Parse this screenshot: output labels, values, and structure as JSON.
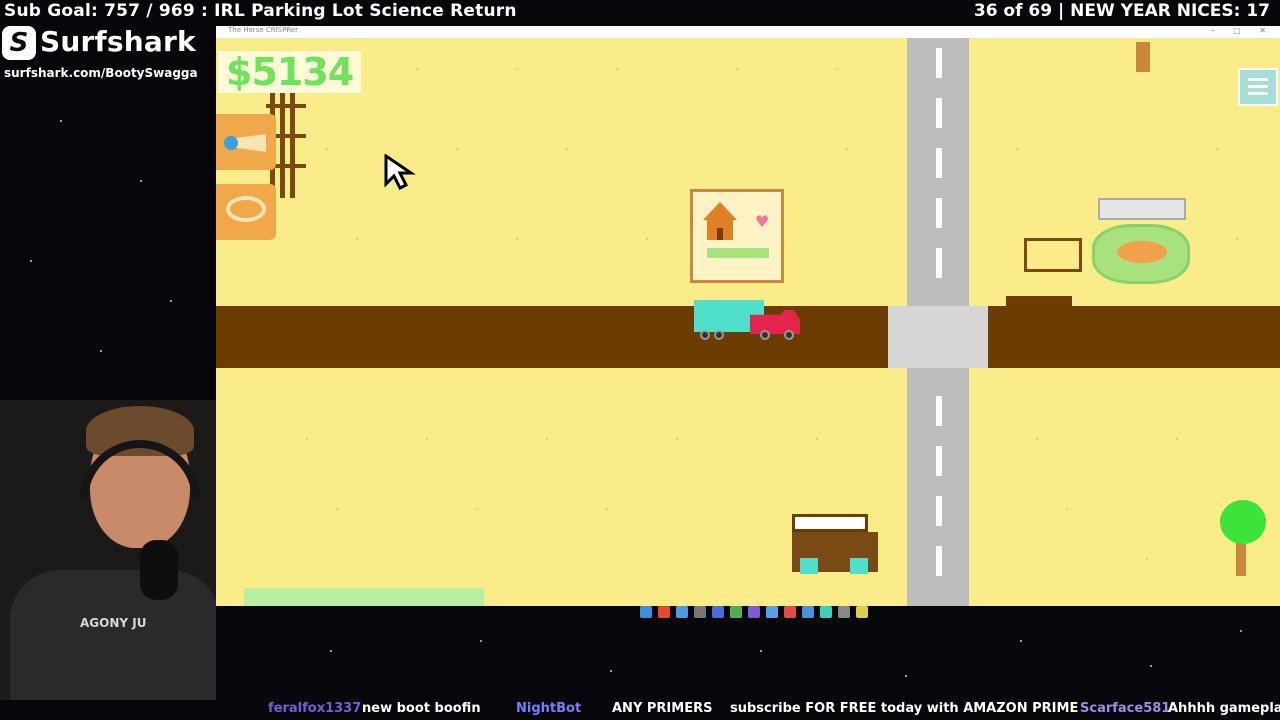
{
  "overlay": {
    "sub_goal": "Sub Goal: 757 / 969 : IRL Parking Lot Science Return",
    "counter": "36 of 69 | NEW YEAR NICES: 17",
    "sponsor_name": "Surfshark",
    "sponsor_url": "surfshark.com/BootySwagga"
  },
  "game": {
    "window_title": "The Horse CRISPRer",
    "money": "$5134"
  },
  "webcam": {
    "shirt_text": "AGONY JU"
  },
  "chat": {
    "user1": "feralfox1337",
    "msg1": "new boot boofin",
    "user2": "NightBot",
    "msg2": "ANY PRIMERS",
    "msg3": "subscribe FOR FREE today with AMAZON PRIME",
    "user3": "Scarface581",
    "msg4": "Ahhhh gameplay"
  },
  "colors": {
    "sand": "#fbec8a",
    "road_dirt": "#6d3c03",
    "road_asphalt": "#bdbdbd",
    "money_green": "#6fe35a"
  }
}
